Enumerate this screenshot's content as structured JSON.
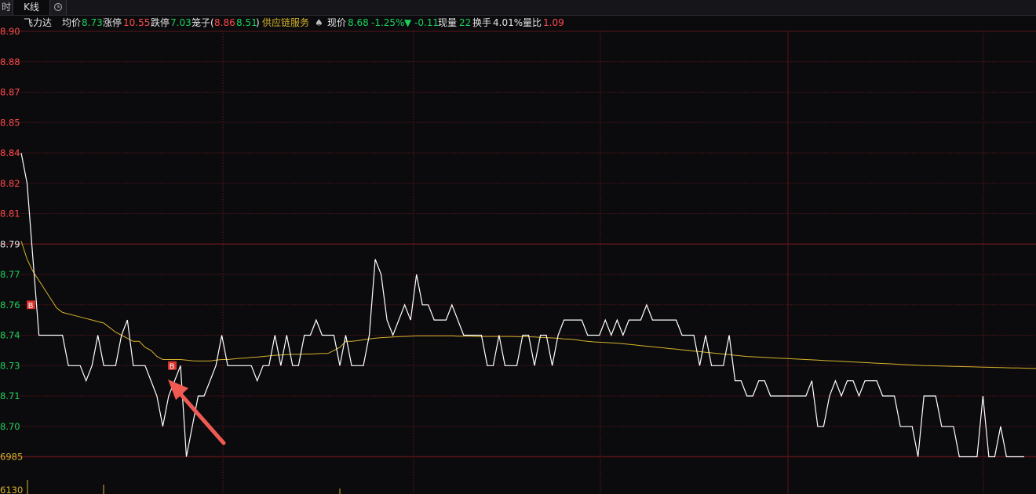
{
  "tabs": [
    {
      "label": "时"
    },
    {
      "label": "K线"
    }
  ],
  "info": {
    "name": "飞力达",
    "avg_label": "均价",
    "avg_value": "8.73",
    "limit_up_label": "涨停",
    "limit_up_value": "10.55",
    "limit_down_label": "跌停",
    "limit_down_value": "7.03",
    "cage_label": "笼子(",
    "cage_high": "8.86",
    "cage_low": "8.51",
    "cage_close": ")",
    "concept": "供应链服务",
    "spade": "♠",
    "price_label": "现价",
    "price_value": "8.68",
    "change_pct": "-1.25%",
    "change_arrow": "▼",
    "change_value": "-0.11",
    "volume_label": "现量",
    "volume_value": "22",
    "turnover_label": "换手",
    "turnover_value": "4.01%",
    "vol_ratio_label": "量比",
    "vol_ratio_value": "1.09"
  },
  "axis": {
    "labels": [
      "8.90",
      "8.88",
      "8.87",
      "8.85",
      "8.84",
      "8.82",
      "8.81",
      "8.79",
      "8.77",
      "8.76",
      "8.74",
      "8.73",
      "8.71",
      "8.70",
      "6985",
      "6130"
    ],
    "colors": [
      "#ff4a4a",
      "#ff4a4a",
      "#ff4a4a",
      "#ff4a4a",
      "#ff4a4a",
      "#ff4a4a",
      "#ff4a4a",
      "#e6e6e6",
      "#19d05a",
      "#19d05a",
      "#19d05a",
      "#19d05a",
      "#19d05a",
      "#19d05a",
      "#d6b32a",
      "#d6b32a"
    ]
  },
  "markers": [
    {
      "label": "B",
      "price": 8.76
    },
    {
      "label": "B",
      "price": 8.73
    }
  ],
  "chart_data": {
    "type": "line",
    "title": "",
    "xlabel": "",
    "ylabel": "",
    "ylim": [
      8.69,
      8.9
    ],
    "price": [
      8.84,
      8.82,
      8.78,
      8.74,
      8.74,
      8.74,
      8.74,
      8.74,
      8.73,
      8.73,
      8.73,
      8.72,
      8.73,
      8.74,
      8.73,
      8.73,
      8.73,
      8.74,
      8.75,
      8.73,
      8.73,
      8.73,
      8.72,
      8.71,
      8.7,
      8.71,
      8.72,
      8.73,
      8.69,
      8.7,
      8.71,
      8.71,
      8.72,
      8.73,
      8.74,
      8.73,
      8.73,
      8.73,
      8.73,
      8.73,
      8.72,
      8.73,
      8.73,
      8.74,
      8.73,
      8.74,
      8.73,
      8.73,
      8.74,
      8.74,
      8.75,
      8.74,
      8.74,
      8.74,
      8.73,
      8.74,
      8.73,
      8.73,
      8.73,
      8.74,
      8.78,
      8.77,
      8.75,
      8.74,
      8.75,
      8.76,
      8.75,
      8.77,
      8.76,
      8.76,
      8.75,
      8.75,
      8.75,
      8.76,
      8.75,
      8.74,
      8.74,
      8.74,
      8.74,
      8.73,
      8.73,
      8.74,
      8.73,
      8.73,
      8.73,
      8.74,
      8.74,
      8.73,
      8.74,
      8.74,
      8.73,
      8.74,
      8.75,
      8.75,
      8.75,
      8.75,
      8.74,
      8.74,
      8.74,
      8.75,
      8.74,
      8.75,
      8.74,
      8.75,
      8.75,
      8.75,
      8.76,
      8.75,
      8.75,
      8.75,
      8.75,
      8.75,
      8.74,
      8.74,
      8.74,
      8.73,
      8.74,
      8.73,
      8.73,
      8.73,
      8.74,
      8.72,
      8.72,
      8.71,
      8.71,
      8.72,
      8.72,
      8.71,
      8.71,
      8.71,
      8.71,
      8.71,
      8.71,
      8.71,
      8.72,
      8.7,
      8.7,
      8.71,
      8.72,
      8.71,
      8.72,
      8.72,
      8.71,
      8.72,
      8.72,
      8.72,
      8.71,
      8.71,
      8.71,
      8.7,
      8.7,
      8.7,
      8.69,
      8.71,
      8.71,
      8.71,
      8.7,
      8.7,
      8.7,
      8.69,
      8.69,
      8.69,
      8.69,
      8.71,
      8.69,
      8.69,
      8.7,
      8.69,
      8.69,
      8.69,
      8.68
    ],
    "avg": [
      8.792,
      8.78,
      8.772,
      8.768,
      8.765,
      8.762,
      8.758,
      8.755,
      8.754,
      8.753,
      8.752,
      8.751,
      8.75,
      8.749,
      8.748,
      8.745,
      8.742,
      8.74,
      8.739,
      8.738,
      8.738,
      8.736,
      8.735,
      8.733,
      8.732,
      8.732,
      8.732,
      8.732,
      8.7318,
      8.7316,
      8.7315,
      8.7315,
      8.7315,
      8.7318,
      8.732,
      8.732,
      8.7322,
      8.7324,
      8.7325,
      8.7327,
      8.7328,
      8.733,
      8.7332,
      8.7334,
      8.7335,
      8.7336,
      8.7337,
      8.7337,
      8.7338,
      8.7338,
      8.7339,
      8.734,
      8.734,
      8.735,
      8.736,
      8.738,
      8.738,
      8.7382,
      8.7385,
      8.7388,
      8.739,
      8.7392,
      8.7393,
      8.7394,
      8.7395,
      8.7396,
      8.7397,
      8.7398,
      8.7398,
      8.7398,
      8.7398,
      8.7398,
      8.7398,
      8.7398,
      8.7397,
      8.7397,
      8.7397,
      8.7396,
      8.7396,
      8.7396,
      8.7396,
      8.7396,
      8.7396,
      8.7396,
      8.7395,
      8.7395,
      8.7395,
      8.7394,
      8.7393,
      8.7392,
      8.7391,
      8.739,
      8.7388,
      8.7387,
      8.7385,
      8.7382,
      8.738,
      8.7378,
      8.7377,
      8.7376,
      8.7375,
      8.7374,
      8.7372,
      8.737,
      8.7368,
      8.7366,
      8.7364,
      8.7362,
      8.736,
      8.7358,
      8.7356,
      8.7354,
      8.7352,
      8.735,
      8.7348,
      8.7346,
      8.7344,
      8.7342,
      8.734,
      8.7338,
      8.7336,
      8.7334,
      8.7332,
      8.733,
      8.7329,
      8.7328,
      8.7327,
      8.7326,
      8.7325,
      8.7324,
      8.7323,
      8.7322,
      8.7321,
      8.732,
      8.7319,
      8.7318,
      8.7317,
      8.7316,
      8.7315,
      8.7314,
      8.7313,
      8.7312,
      8.7311,
      8.731,
      8.7309,
      8.7308,
      8.7307,
      8.7306,
      8.7305,
      8.7304,
      8.7303,
      8.7302,
      8.7301,
      8.73,
      8.7299,
      8.7298,
      8.7297,
      8.7296,
      8.7295,
      8.7294,
      8.7293,
      8.7292,
      8.7291,
      8.729,
      8.7289,
      8.7288,
      8.7287,
      8.7286,
      8.7285,
      8.7284,
      8.7283,
      8.7282,
      8.7281,
      8.728,
      8.7279,
      8.7278,
      8.7277,
      8.7276,
      8.7275
    ]
  },
  "colors": {
    "background": "#0b0b0e",
    "grid": "#5a1418",
    "price_line": "#ffffff",
    "avg_line": "#d6b32a",
    "arrow": "#f05a52",
    "marker_bg": "#d8302a"
  }
}
